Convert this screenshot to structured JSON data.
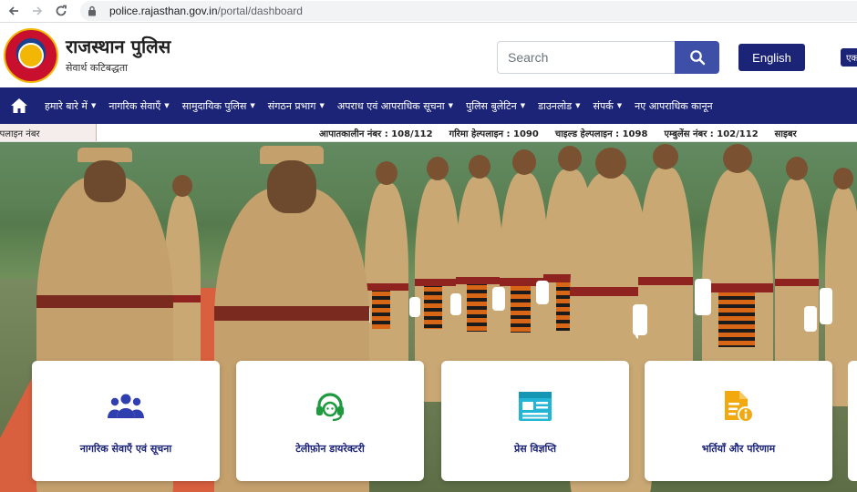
{
  "browser": {
    "url_host": "police.rajasthan.gov.in",
    "url_path": "/portal/dashboard",
    "icons": [
      "back-arrow-icon",
      "forward-arrow-icon",
      "reload-icon",
      "lock-icon"
    ]
  },
  "header": {
    "title": "राजस्थान पुलिस",
    "tagline": "सेवार्थ कटिबद्धता",
    "search_placeholder": "Search",
    "lang_button": "English",
    "lang_button_2": "एक"
  },
  "nav": {
    "items": [
      {
        "label": "हमारे बारे में",
        "has_dropdown": true
      },
      {
        "label": "नागरिक सेवाएँ",
        "has_dropdown": true
      },
      {
        "label": "सामुदायिक पुलिस",
        "has_dropdown": true
      },
      {
        "label": "संगठन प्रभाग",
        "has_dropdown": true
      },
      {
        "label": "अपराध एवं आपराधिक सूचना",
        "has_dropdown": true
      },
      {
        "label": "पुलिस बुलेटिन",
        "has_dropdown": true
      },
      {
        "label": "डाउनलोड",
        "has_dropdown": true
      },
      {
        "label": "संपर्क",
        "has_dropdown": true
      },
      {
        "label": "नए आपराधिक कानून",
        "has_dropdown": false
      }
    ]
  },
  "ticker": {
    "label": "हेल्पलाइन नंबर",
    "items": [
      "आपातकालीन नंबर : 108/112",
      "गरिमा हेल्पलाइन : 1090",
      "चाइल्ड हेल्पलाइन : 1098",
      "एम्बुलेंस नंबर : 102/112",
      "साइबर"
    ]
  },
  "cards": [
    {
      "label": "नागरिक सेवाएँ एवं सूचना",
      "icon": "group-icon"
    },
    {
      "label": "टेलीफ़ोन डायरेक्टरी",
      "icon": "headset-icon"
    },
    {
      "label": "प्रेस विज्ञप्ति",
      "icon": "newspaper-icon"
    },
    {
      "label": "भर्तियाँ और परिणाम",
      "icon": "document-info-icon"
    }
  ],
  "colors": {
    "nav_bg": "#1c2478",
    "search_btn": "#3e4fa8",
    "group_icon": "#2f3fb0",
    "headset_icon": "#1f9a3e",
    "newspaper_icon": "#22b5d6",
    "document_icon": "#f2a90f"
  }
}
